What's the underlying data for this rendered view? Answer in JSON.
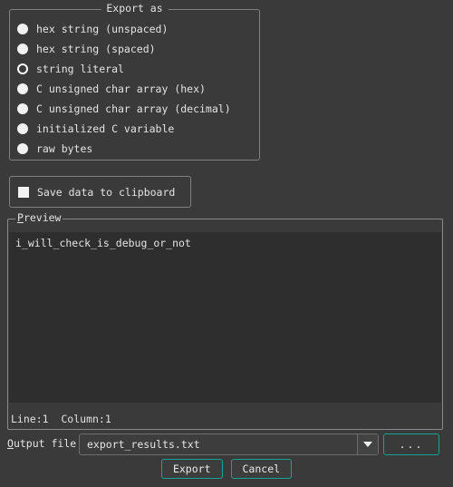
{
  "dialog": {
    "background_color": "#3a3a3a",
    "accent_color": "#17a294"
  },
  "export_as_group": {
    "title": "Export as",
    "options": [
      {
        "label": "hex string (unspaced)",
        "selected": false
      },
      {
        "label": "hex string (spaced)",
        "selected": false
      },
      {
        "label": "string literal",
        "selected": true
      },
      {
        "label": "C unsigned char array (hex)",
        "selected": false
      },
      {
        "label": "C unsigned char array (decimal)",
        "selected": false
      },
      {
        "label": "initialized C variable",
        "selected": false
      },
      {
        "label": "raw bytes",
        "selected": false
      }
    ]
  },
  "clipboard": {
    "label": "Save data to clipboard",
    "checked": false
  },
  "preview": {
    "title_mnemonic": "P",
    "title_rest": "review",
    "content": "i_will_check_is_debug_or_not",
    "status": "Line:1  Column:1"
  },
  "output_file": {
    "label_mnemonic": "O",
    "label_rest": "utput file",
    "value": "export_results.txt",
    "dropdown_icon": "chevron-down-icon",
    "browse_label": "..."
  },
  "buttons": {
    "export_label": "Export",
    "cancel_label": "Cancel"
  }
}
